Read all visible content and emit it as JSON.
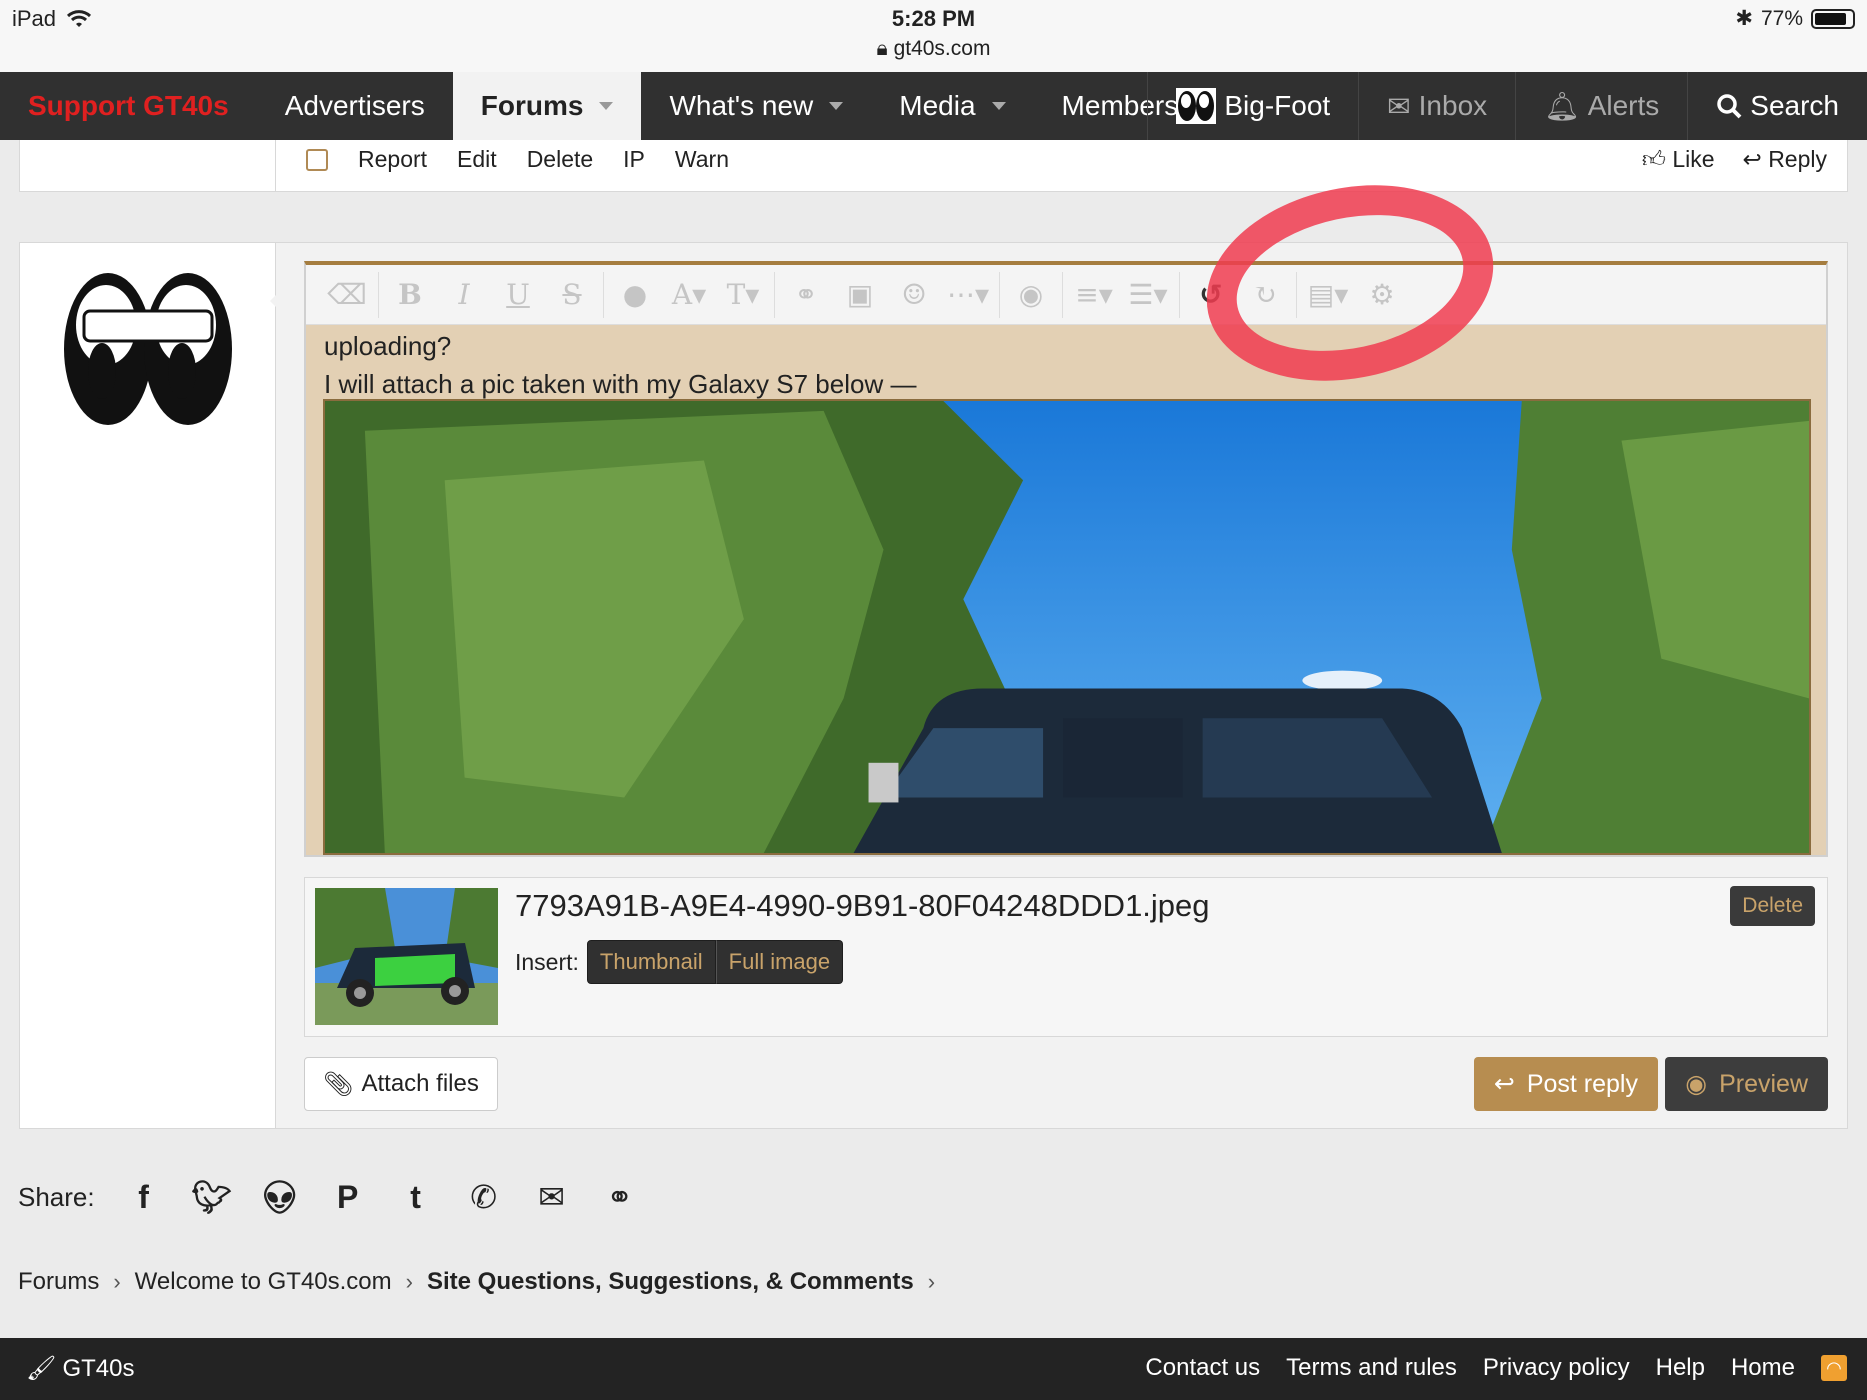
{
  "statusbar": {
    "device": "iPad",
    "time": "5:28 PM",
    "url": "gt40s.com",
    "battery": "77%"
  },
  "nav": {
    "support": "Support GT40s",
    "advertisers": "Advertisers",
    "forums": "Forums",
    "whats_new": "What's new",
    "media": "Media",
    "members": "Members",
    "user": "Big-Foot",
    "inbox": "Inbox",
    "alerts": "Alerts",
    "search": "Search"
  },
  "post_actions": {
    "report": "Report",
    "edit": "Edit",
    "delete": "Delete",
    "ip": "IP",
    "warn": "Warn",
    "like": "Like",
    "reply": "Reply"
  },
  "editor": {
    "line1": "uploading?",
    "line2": "I will attach a pic taken with my Galaxy S7 below —"
  },
  "attachment": {
    "filename": "7793A91B-A9E4-4990-9B91-80F04248DDD1.jpeg",
    "insert_label": "Insert:",
    "thumbnail": "Thumbnail",
    "full_image": "Full image",
    "delete": "Delete"
  },
  "buttons": {
    "attach_files": "Attach files",
    "post_reply": "Post reply",
    "preview": "Preview"
  },
  "share": {
    "label": "Share:",
    "icons": [
      "facebook-icon",
      "twitter-icon",
      "reddit-icon",
      "pinterest-icon",
      "tumblr-icon",
      "whatsapp-icon",
      "email-icon",
      "link-icon"
    ]
  },
  "breadcrumb": {
    "forums": "Forums",
    "welcome": "Welcome to GT40s.com",
    "section": "Site Questions, Suggestions, & Comments"
  },
  "footer": {
    "brand": "GT40s",
    "contact": "Contact us",
    "terms": "Terms and rules",
    "privacy": "Privacy policy",
    "help": "Help",
    "home": "Home"
  },
  "colors": {
    "accent": "#b78d50",
    "nav_bg": "#303030",
    "support_red": "#e02020",
    "annotation_red": "#f03c50"
  }
}
